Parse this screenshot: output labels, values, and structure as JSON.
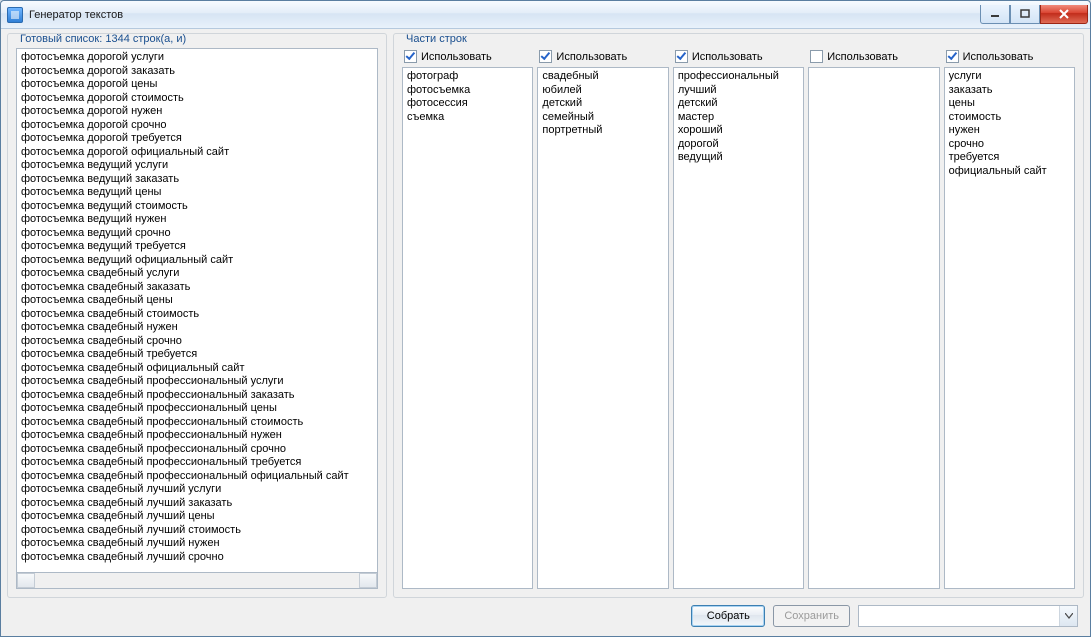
{
  "window": {
    "title": "Генератор текстов"
  },
  "left_panel": {
    "legend": "Готовый список: 1344 строк(а, и)",
    "items": [
      "фотосъемка дорогой услуги",
      "фотосъемка дорогой заказать",
      "фотосъемка дорогой цены",
      "фотосъемка дорогой стоимость",
      "фотосъемка дорогой нужен",
      "фотосъемка дорогой срочно",
      "фотосъемка дорогой требуется",
      "фотосъемка дорогой официальный сайт",
      "фотосъемка ведущий услуги",
      "фотосъемка ведущий заказать",
      "фотосъемка ведущий цены",
      "фотосъемка ведущий стоимость",
      "фотосъемка ведущий нужен",
      "фотосъемка ведущий срочно",
      "фотосъемка ведущий требуется",
      "фотосъемка ведущий официальный сайт",
      "фотосъемка свадебный услуги",
      "фотосъемка свадебный заказать",
      "фотосъемка свадебный цены",
      "фотосъемка свадебный стоимость",
      "фотосъемка свадебный нужен",
      "фотосъемка свадебный срочно",
      "фотосъемка свадебный требуется",
      "фотосъемка свадебный официальный сайт",
      "фотосъемка свадебный профессиональный услуги",
      "фотосъемка свадебный профессиональный заказать",
      "фотосъемка свадебный профессиональный цены",
      "фотосъемка свадебный профессиональный стоимость",
      "фотосъемка свадебный профессиональный нужен",
      "фотосъемка свадебный профессиональный срочно",
      "фотосъемка свадебный профессиональный требуется",
      "фотосъемка свадебный профессиональный официальный сайт",
      "фотосъемка свадебный лучший услуги",
      "фотосъемка свадебный лучший заказать",
      "фотосъемка свадебный лучший цены",
      "фотосъемка свадебный лучший стоимость",
      "фотосъемка свадебный лучший нужен",
      "фотосъемка свадебный лучший срочно"
    ]
  },
  "right_panel": {
    "legend": "Части строк",
    "checkbox_label": "Использовать",
    "columns": [
      {
        "checked": true,
        "items": [
          "фотограф",
          "фотосъемка",
          "фотосессия",
          "съемка"
        ]
      },
      {
        "checked": true,
        "items": [
          "свадебный",
          "юбилей",
          "детский",
          "семейный",
          "портретный"
        ]
      },
      {
        "checked": true,
        "items": [
          "профессиональный",
          "лучший",
          "детский",
          "мастер",
          "хороший",
          "дорогой",
          "ведущий"
        ]
      },
      {
        "checked": false,
        "items": []
      },
      {
        "checked": true,
        "items": [
          "услуги",
          "заказать",
          "цены",
          "стоимость",
          "нужен",
          "срочно",
          "требуется",
          "официальный сайт"
        ]
      }
    ]
  },
  "buttons": {
    "build": "Собрать",
    "save": "Сохранить"
  }
}
